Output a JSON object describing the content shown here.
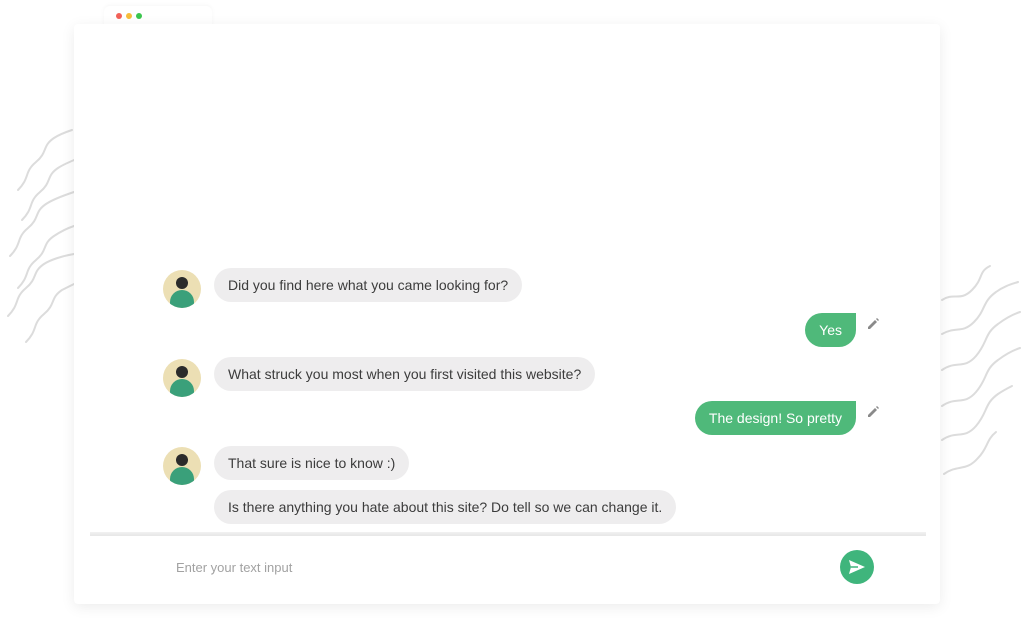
{
  "window": {
    "controls": [
      {
        "name": "close",
        "color": "#f26158"
      },
      {
        "name": "minimize",
        "color": "#f7bd3a"
      },
      {
        "name": "maximize",
        "color": "#3bc64e"
      }
    ]
  },
  "chat": {
    "messages": [
      {
        "sender": "bot",
        "text": "Did you find here what you came looking for?"
      },
      {
        "sender": "user",
        "text": "Yes",
        "action_icon": "pencil-icon"
      },
      {
        "sender": "bot",
        "text": "What struck you most when you first visited this website?"
      },
      {
        "sender": "user",
        "text": "The design! So pretty",
        "action_icon": "pencil-icon"
      },
      {
        "sender": "bot",
        "text": "That sure is nice to know :)"
      },
      {
        "sender": "bot",
        "text": "Is there anything you hate about this site? Do tell so we can change it."
      }
    ]
  },
  "composer": {
    "placeholder": "Enter your text input",
    "send_icon": "paper-plane-icon"
  },
  "colors": {
    "accent": "#4fb97a",
    "bot_bubble": "#eeedee",
    "avatar_bg": "#ecdfb4",
    "avatar_body": "#3aa07a"
  }
}
